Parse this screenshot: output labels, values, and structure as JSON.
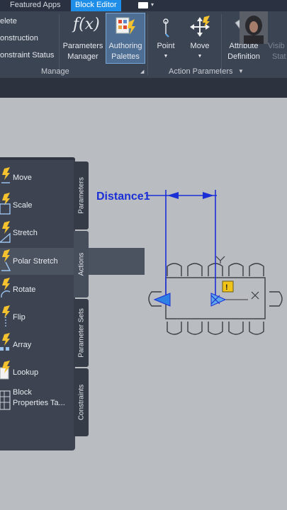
{
  "tabs": {
    "featured_apps": "Featured Apps",
    "block_editor": "Block Editor"
  },
  "ribbon": {
    "left_items": [
      "elete",
      "onstruction",
      "onstraint Status"
    ],
    "parameters_manager": {
      "line1": "Parameters",
      "line2": "Manager"
    },
    "authoring_palettes": {
      "line1": "Authoring",
      "line2": "Palettes"
    },
    "point": "Point",
    "move": "Move",
    "attribute_definition": {
      "line1": "Attribute",
      "line2": "Definition"
    },
    "visibility": {
      "line1": "Visib",
      "line2": "Stat"
    },
    "manage_group": "Manage",
    "action_parameters_group": "Action Parameters",
    "fx_glyph": "f(x)"
  },
  "palette": {
    "items": [
      {
        "label": "Move"
      },
      {
        "label": "Scale"
      },
      {
        "label": "Stretch"
      },
      {
        "label": "Polar Stretch"
      },
      {
        "label": "Rotate"
      },
      {
        "label": "Flip"
      },
      {
        "label": "Array"
      },
      {
        "label": "Lookup"
      },
      {
        "label": "Block",
        "label2": "Properties Ta..."
      }
    ],
    "side_tabs": [
      "Parameters",
      "Actions",
      "Parameter Sets",
      "Constraints"
    ]
  },
  "canvas": {
    "dimension_label": "Distance1",
    "warning_glyph": "!"
  },
  "colors": {
    "accent": "#1f8ee8",
    "ribbon": "#3b4453",
    "canvas": "#b9bcc1",
    "dimension": "#1b2fd6"
  }
}
